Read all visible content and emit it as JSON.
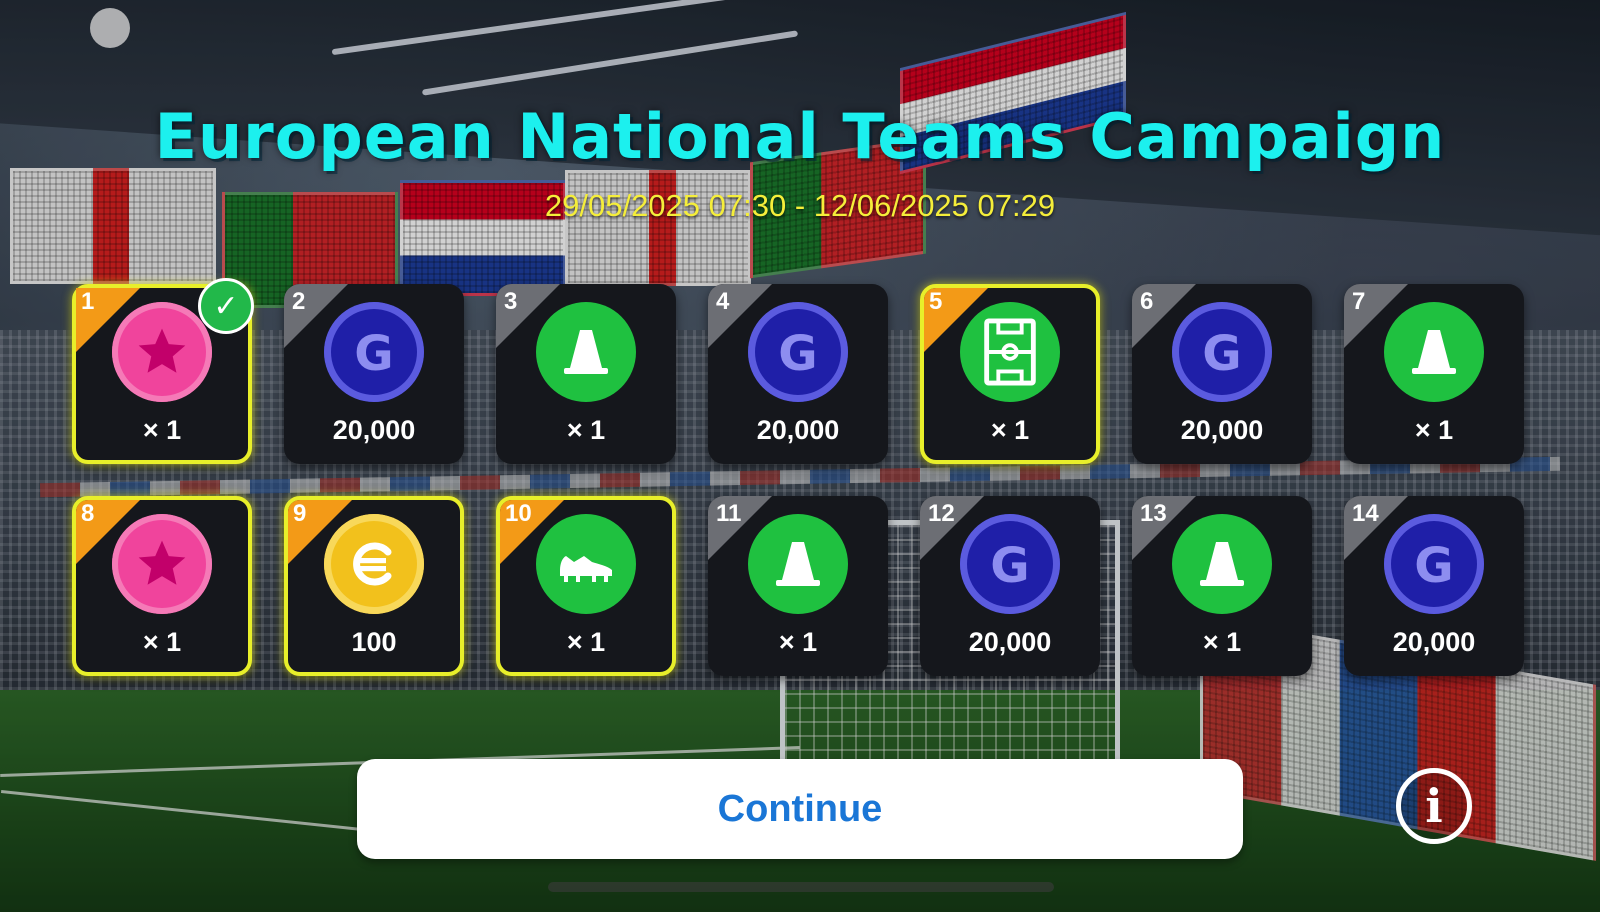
{
  "header": {
    "title": "European National Teams Campaign",
    "dates": "29/05/2025 07:30 - 12/06/2025 07:29"
  },
  "colors": {
    "title": "#1cf0ee",
    "dates": "#f5ee3a",
    "highlight_border": "#e8ef2a",
    "highlight_corner": "#f39a17",
    "normal_corner": "#6c6e74",
    "continue_text": "#1a76d6"
  },
  "rewards": [
    {
      "day": "1",
      "icon": "star-coin-icon",
      "qty": "× 1",
      "highlighted": true,
      "claimed": true
    },
    {
      "day": "2",
      "icon": "gp-coin-icon",
      "qty": "20,000",
      "highlighted": false,
      "claimed": false
    },
    {
      "day": "3",
      "icon": "training-cone-icon",
      "qty": "× 1",
      "highlighted": false,
      "claimed": false
    },
    {
      "day": "4",
      "icon": "gp-coin-icon",
      "qty": "20,000",
      "highlighted": false,
      "claimed": false
    },
    {
      "day": "5",
      "icon": "pitch-icon",
      "qty": "× 1",
      "highlighted": true,
      "claimed": false
    },
    {
      "day": "6",
      "icon": "gp-coin-icon",
      "qty": "20,000",
      "highlighted": false,
      "claimed": false
    },
    {
      "day": "7",
      "icon": "training-cone-icon",
      "qty": "× 1",
      "highlighted": false,
      "claimed": false
    },
    {
      "day": "8",
      "icon": "star-coin-icon",
      "qty": "× 1",
      "highlighted": true,
      "claimed": false
    },
    {
      "day": "9",
      "icon": "efootball-coin-icon",
      "qty": "100",
      "highlighted": true,
      "claimed": false
    },
    {
      "day": "10",
      "icon": "boot-icon",
      "qty": "× 1",
      "highlighted": true,
      "claimed": false
    },
    {
      "day": "11",
      "icon": "training-cone-icon",
      "qty": "× 1",
      "highlighted": false,
      "claimed": false
    },
    {
      "day": "12",
      "icon": "gp-coin-icon",
      "qty": "20,000",
      "highlighted": false,
      "claimed": false
    },
    {
      "day": "13",
      "icon": "training-cone-icon",
      "qty": "× 1",
      "highlighted": false,
      "claimed": false
    },
    {
      "day": "14",
      "icon": "gp-coin-icon",
      "qty": "20,000",
      "highlighted": false,
      "claimed": false
    }
  ],
  "footer": {
    "continue_label": "Continue",
    "info_icon": "info-icon",
    "info_glyph": "i"
  }
}
